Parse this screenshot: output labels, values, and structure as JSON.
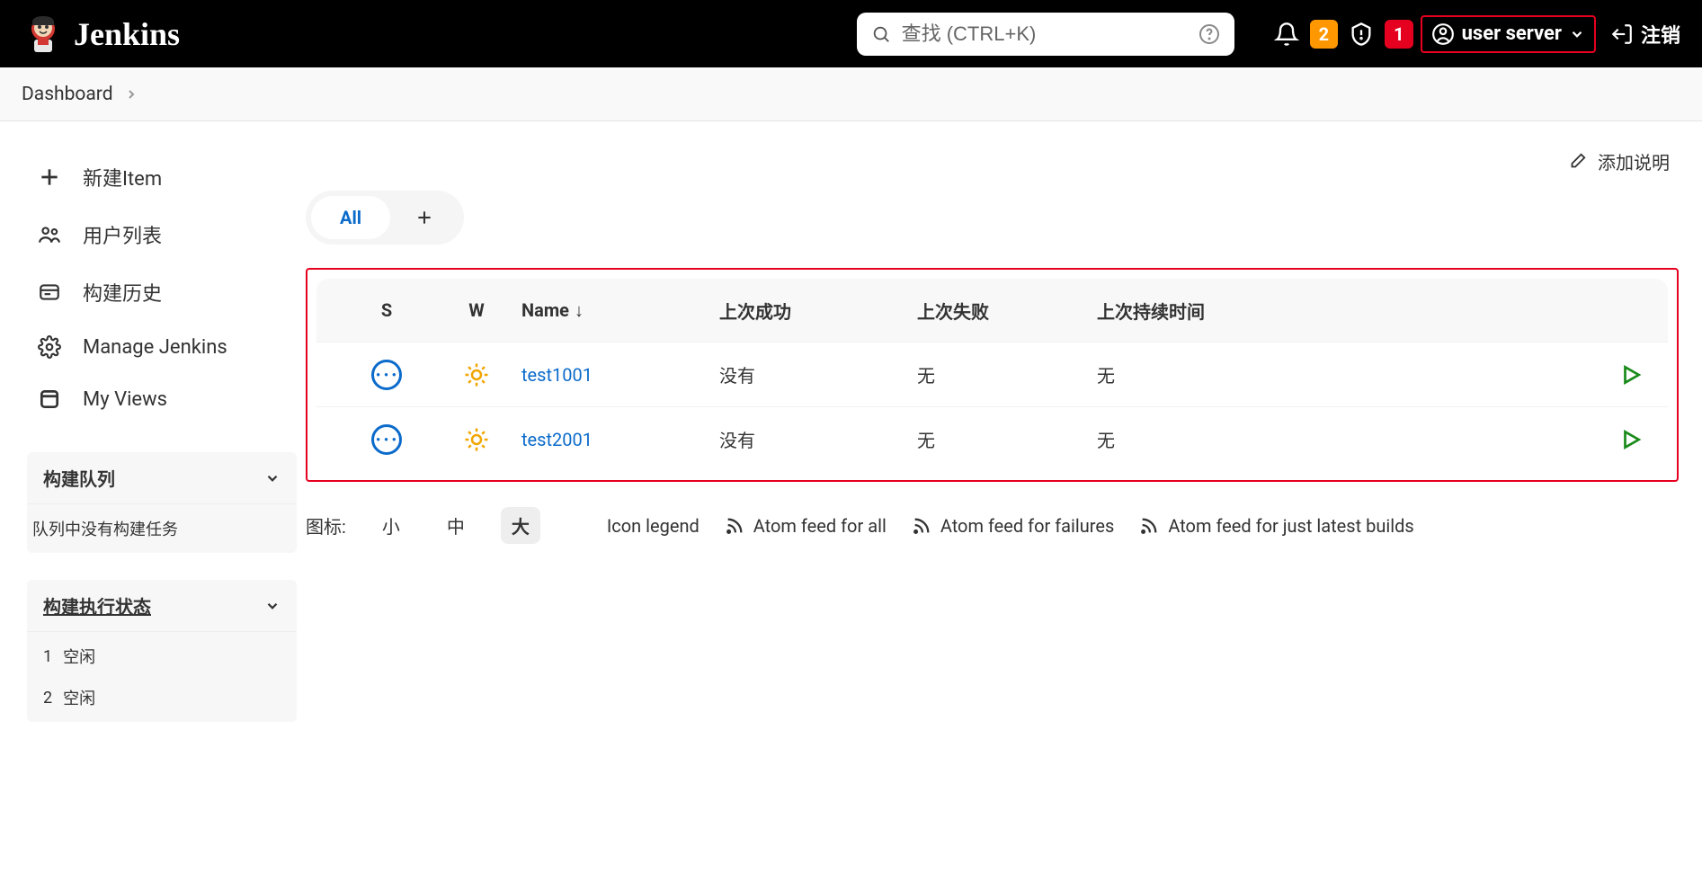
{
  "header": {
    "brand": "Jenkins",
    "search_placeholder": "查找 (CTRL+K)",
    "notif_count": "2",
    "security_alert_count": "1",
    "user_label": "user server",
    "logout_label": "注销"
  },
  "breadcrumb": {
    "dashboard": "Dashboard"
  },
  "sidebar": {
    "new_item": "新建Item",
    "people": "用户列表",
    "build_history": "构建历史",
    "manage": "Manage Jenkins",
    "my_views": "My Views",
    "queue_title": "构建队列",
    "queue_empty_text": "队列中没有构建任务",
    "executor_title": "构建执行状态",
    "executor_rows": [
      {
        "num": "1",
        "state": "空闲"
      },
      {
        "num": "2",
        "state": "空闲"
      }
    ]
  },
  "main": {
    "add_description": "添加说明",
    "tab_all": "All",
    "columns": {
      "s": "S",
      "w": "W",
      "name": "Name",
      "sort_arrow": "↓",
      "last_success": "上次成功",
      "last_failure": "上次失败",
      "last_duration": "上次持续时间"
    },
    "jobs": [
      {
        "name": "test1001",
        "last_success": "没有",
        "last_failure": "无",
        "last_duration": "无"
      },
      {
        "name": "test2001",
        "last_success": "没有",
        "last_failure": "无",
        "last_duration": "无"
      }
    ],
    "footer": {
      "icon_label": "图标:",
      "size_small": "小",
      "size_med": "中",
      "size_large": "大",
      "legend": "Icon legend",
      "feed_all": "Atom feed for all",
      "feed_failures": "Atom feed for failures",
      "feed_latest": "Atom feed for just latest builds"
    }
  }
}
